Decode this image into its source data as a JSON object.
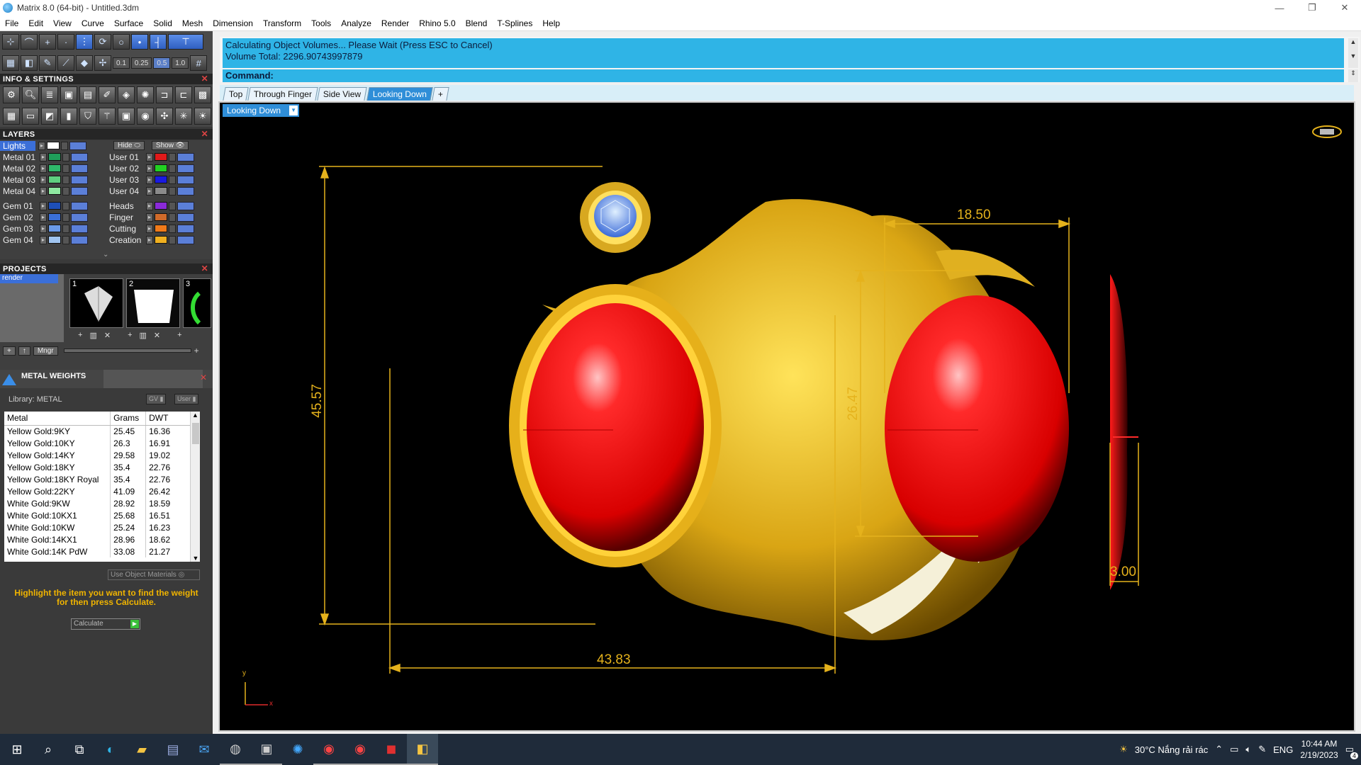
{
  "window": {
    "title": "Matrix 8.0 (64-bit) - Untitled.3dm",
    "minimize": "—",
    "restore": "❐",
    "close": "✕"
  },
  "menu": [
    "File",
    "Edit",
    "View",
    "Curve",
    "Surface",
    "Solid",
    "Mesh",
    "Dimension",
    "Transform",
    "Tools",
    "Analyze",
    "Render",
    "Rhino 5.0",
    "Blend",
    "T-Splines",
    "Help"
  ],
  "toolbar": {
    "values": [
      "0.1",
      "0.25",
      "0.5",
      "1.0"
    ]
  },
  "panels": {
    "info_settings": "INFO & SETTINGS",
    "layers": "LAYERS",
    "projects": "PROJECTS",
    "metal_weights": "METAL WEIGHTS"
  },
  "layers": {
    "top": {
      "name": "Lights",
      "hide": "Hide",
      "show": "Show"
    },
    "left": [
      {
        "name": "Metal 01",
        "color": "#1f9e5a"
      },
      {
        "name": "Metal 02",
        "color": "#2fb86a"
      },
      {
        "name": "Metal 03",
        "color": "#5fd080"
      },
      {
        "name": "Metal 04",
        "color": "#8ee8a0"
      },
      {
        "name": "Gem 01",
        "color": "#1e4fb8"
      },
      {
        "name": "Gem 02",
        "color": "#3a6fd8"
      },
      {
        "name": "Gem 03",
        "color": "#6a9ae8"
      },
      {
        "name": "Gem 04",
        "color": "#a0c4f0"
      }
    ],
    "right": [
      {
        "name": "User 01",
        "color": "#e01a1a"
      },
      {
        "name": "User 02",
        "color": "#22d022"
      },
      {
        "name": "User 03",
        "color": "#1a1ae0"
      },
      {
        "name": "User 04",
        "color": "#8a8a8a"
      },
      {
        "name": "Heads",
        "color": "#8a2ad8"
      },
      {
        "name": "Finger",
        "color": "#d06a2a"
      },
      {
        "name": "Cutting",
        "color": "#f07a1a"
      },
      {
        "name": "Creation",
        "color": "#f0b020"
      }
    ]
  },
  "projects": {
    "item": "render",
    "thumbs": [
      "1",
      "2",
      "3"
    ],
    "mngr": "Mngr"
  },
  "metal_weights": {
    "library": "Library: METAL",
    "gv": "GV",
    "user": "User",
    "columns": [
      "Metal",
      "Grams",
      "DWT"
    ],
    "rows": [
      [
        "Yellow Gold:9KY",
        "25.45",
        "16.36"
      ],
      [
        "Yellow Gold:10KY",
        "26.3",
        "16.91"
      ],
      [
        "Yellow Gold:14KY",
        "29.58",
        "19.02"
      ],
      [
        "Yellow Gold:18KY",
        "35.4",
        "22.76"
      ],
      [
        "Yellow Gold:18KY Royal",
        "35.4",
        "22.76"
      ],
      [
        "Yellow Gold:22KY",
        "41.09",
        "26.42"
      ],
      [
        "White Gold:9KW",
        "28.92",
        "18.59"
      ],
      [
        "White Gold:10KX1",
        "25.68",
        "16.51"
      ],
      [
        "White Gold:10KW",
        "25.24",
        "16.23"
      ],
      [
        "White Gold:14KX1",
        "28.96",
        "18.62"
      ],
      [
        "White Gold:14K PdW",
        "33.08",
        "21.27"
      ]
    ],
    "use_object_materials": "Use Object Materials",
    "hint": "Highlight the item you want to find the weight for then press Calculate.",
    "calculate": "Calculate"
  },
  "command": {
    "line1": "Calculating Object Volumes... Please Wait (Press ESC to Cancel)",
    "line2": "Volume Total: 2296.90743997879",
    "prompt": "Command:"
  },
  "tabs": [
    "Top",
    "Through Finger",
    "Side View",
    "Looking Down",
    "+"
  ],
  "viewport": {
    "label": "Looking Down",
    "dims": {
      "height": "45.57",
      "width": "43.83",
      "stone_width": "18.50",
      "stone_height": "26.47",
      "stone_depth": "3.00"
    },
    "axis_y": "y",
    "axis_x": "x"
  },
  "taskbar": {
    "weather": "30°C  Nắng rải rác",
    "lang": "ENG",
    "time": "10:44 AM",
    "date": "2/19/2023",
    "notif": "4"
  }
}
